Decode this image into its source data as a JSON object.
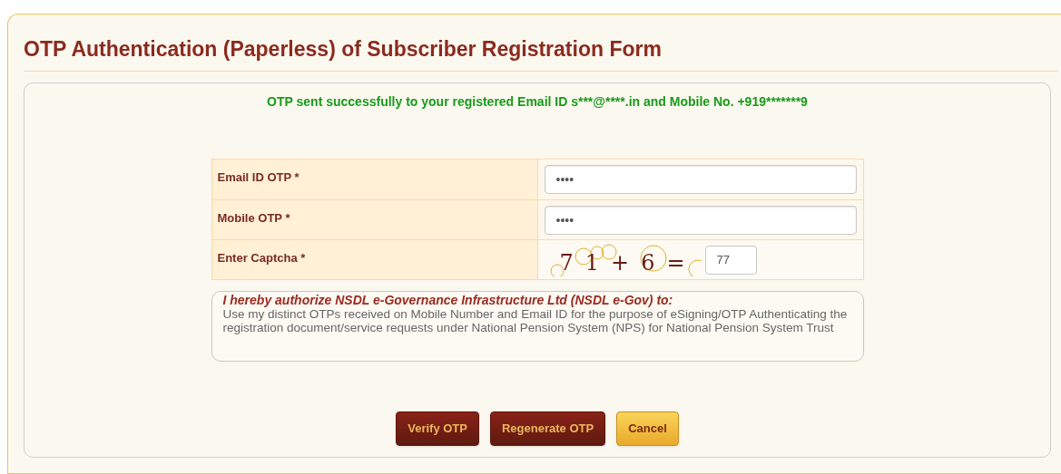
{
  "title": "OTP Authentication (Paperless) of Subscriber Registration Form",
  "message": "OTP sent successfully to your registered Email ID s***@****.in and Mobile No. +919*******9",
  "fields": [
    {
      "kind": "input",
      "label": "Email ID OTP *",
      "value": "••••"
    },
    {
      "kind": "input",
      "label": "Mobile OTP *",
      "value": "••••"
    },
    {
      "kind": "captcha",
      "label": "Enter Captcha *",
      "captcha": "71+6=",
      "value": "77"
    }
  ],
  "authorization": {
    "heading": "I hereby authorize NSDL e-Governance Infrastructure Ltd (NSDL e-Gov) to:",
    "text": "Use my distinct OTPs received on Mobile Number and Email ID for the purpose of eSigning/OTP Authenticating the registration document/service requests under National Pension System (NPS) for National Pension System Trust"
  },
  "buttons": [
    {
      "label": "Verify OTP",
      "kind": "primary"
    },
    {
      "label": "Regenerate OTP",
      "kind": "primary"
    },
    {
      "label": "Cancel",
      "kind": "secondary"
    }
  ]
}
